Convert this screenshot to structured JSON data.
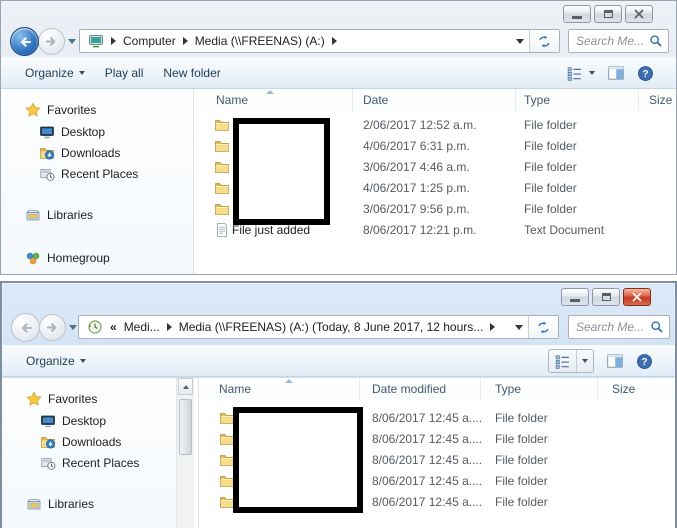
{
  "colors": {
    "active_close_button": "#c93a22",
    "chrome_blue_active": "#cbddf0",
    "chrome_gray_inactive": "#e0e7ef",
    "folder_yellow": "#f0cf6a",
    "accent_blue": "#2f6fb5"
  },
  "icons": {
    "top_breadcrumb_root": "network-computer-icon",
    "bottom_breadcrumb_root": "history-clock-icon",
    "search": "magnifier-icon",
    "refresh": "refresh-icon",
    "views": "list-view-icon",
    "preview": "preview-pane-icon",
    "help": "help-icon",
    "sort": "sort-ascending-icon"
  },
  "top_window": {
    "breadcrumb": {
      "items": [
        "Computer",
        "Media (\\\\FREENAS) (A:)"
      ]
    },
    "search_placeholder": "Search Me...",
    "toolbar": {
      "organize": "Organize",
      "play_all": "Play all",
      "new_folder": "New folder"
    },
    "sidebar": {
      "items": [
        {
          "label": "Favorites"
        },
        {
          "label": "Desktop"
        },
        {
          "label": "Downloads"
        },
        {
          "label": "Recent Places"
        },
        {
          "label": "Libraries"
        },
        {
          "label": "Homegroup"
        }
      ]
    },
    "list": {
      "columns": [
        "Name",
        "Date",
        "Type",
        "Size"
      ],
      "rows": [
        {
          "name": "",
          "date": "2/06/2017 12:52 a.m.",
          "type": "File folder",
          "size": ""
        },
        {
          "name": "",
          "date": "4/06/2017 6:31 p.m.",
          "type": "File folder",
          "size": ""
        },
        {
          "name": "",
          "date": "3/06/2017 4:46 a.m.",
          "type": "File folder",
          "size": ""
        },
        {
          "name": "",
          "date": "4/06/2017 1:25 p.m.",
          "type": "File folder",
          "size": ""
        },
        {
          "name": "",
          "date": "3/06/2017 9:56 p.m.",
          "type": "File folder",
          "size": ""
        },
        {
          "name": "File just added",
          "date": "8/06/2017 12:21 p.m.",
          "type": "Text Document",
          "size": ""
        }
      ]
    }
  },
  "bottom_window": {
    "breadcrumb": {
      "overflow": "«",
      "items": [
        "Medi...",
        "Media (\\\\FREENAS) (A:) (Today, 8 June 2017, 12 hours..."
      ]
    },
    "search_placeholder": "Search Me...",
    "toolbar": {
      "organize": "Organize"
    },
    "sidebar": {
      "items": [
        {
          "label": "Favorites"
        },
        {
          "label": "Desktop"
        },
        {
          "label": "Downloads"
        },
        {
          "label": "Recent Places"
        },
        {
          "label": "Libraries"
        }
      ]
    },
    "list": {
      "columns": [
        "Name",
        "Date modified",
        "Type",
        "Size"
      ],
      "rows": [
        {
          "name": "",
          "date": "8/06/2017 12:45 a....",
          "type": "File folder",
          "size": ""
        },
        {
          "name": "",
          "date": "8/06/2017 12:45 a....",
          "type": "File folder",
          "size": ""
        },
        {
          "name": "",
          "date": "8/06/2017 12:45 a....",
          "type": "File folder",
          "size": ""
        },
        {
          "name": "",
          "date": "8/06/2017 12:45 a....",
          "type": "File folder",
          "size": ""
        },
        {
          "name": "",
          "date": "8/06/2017 12:45 a....",
          "type": "File folder",
          "size": ""
        }
      ]
    }
  }
}
